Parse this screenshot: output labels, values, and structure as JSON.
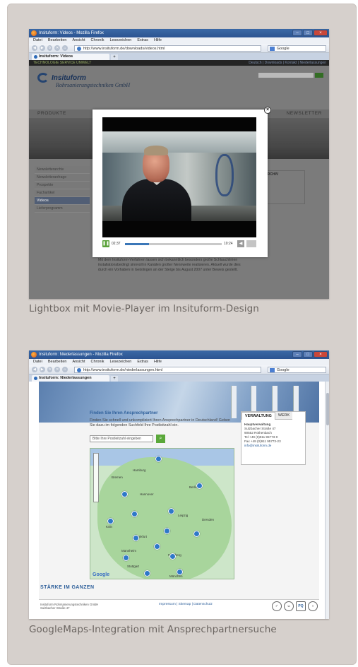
{
  "panels": [
    {
      "window_title": "Insituform: Videos - Mozilla Firefox",
      "menu": [
        "Datei",
        "Bearbeiten",
        "Ansicht",
        "Chronik",
        "Lesezeichen",
        "Extras",
        "Hilfe"
      ],
      "url": "http://www.insituform.de/downloads/videos.html",
      "search_engine": "Google",
      "tab_label": "Insituform: Videos",
      "caption": "Lightbox mit Movie-Player im Insituform-Design"
    },
    {
      "window_title": "Insituform: Niederlassungen - Mozilla Firefox",
      "menu": [
        "Datei",
        "Bearbeiten",
        "Ansicht",
        "Chronik",
        "Lesezeichen",
        "Extras",
        "Hilfe"
      ],
      "url": "http://www.insituform.de/niederlassungen.html",
      "search_engine": "Google",
      "tab_label": "Insituform: Niederlassungen",
      "caption": "GoogleMaps-Integration mit Ansprechpartnersuche"
    }
  ],
  "site1": {
    "top_strip": "TECHNOLOGIE  SERVICE  UMWELT",
    "top_links": "Deutsch | Downloads | Kontakt | Niederlassungen",
    "logo_name": "Insituform",
    "logo_sub": "Rohrsanierungstechniken GmbH",
    "nav_left": "PRODUKTE",
    "nav_right": "NEWSLETTER",
    "sidenav": [
      "Newsletterarchiv",
      "Newsletteranfrage",
      "Prospekte",
      "Fachartikel",
      "Videos",
      "Lieferprogramm"
    ],
    "sidenav_active": 4,
    "archiv_title": "ARCHIV",
    "body_text": "Mit dem Insituform-Verfahren lassen sich bekanntlich besonders große Schlauchlinien installationsbedingt sinnvoll in Kanälen großer Nennweite realisieren. Aktuell wurde dies durch ein Vorhaben in Geislingen an der Steige bis August 2007 unter Beweis gestellt.",
    "player": {
      "current_time": "02:37",
      "total_time": "10:24",
      "progress": 0.25
    }
  },
  "site2": {
    "finder_title": "Finden Sie Ihren Ansprechpartner",
    "finder_text": "Finden Sie schnell und unkompliziert Ihren Ansprechpartner in Deutschland! Geben Sie dazu im folgenden Suchfeld Ihre Postleitzahl ein.",
    "plz_placeholder": "Bitte Ihre Postleitzahl eingeben",
    "tabs": [
      "VERWALTUNG",
      "WERK"
    ],
    "hq_title": "Hauptverwaltung",
    "hq_lines": [
      "Sulzbacher Straße 47",
      "90552 Röthenbach",
      "Tel +49 (0)911 95773-0",
      "Fax +49 (0)911 95773-23"
    ],
    "hq_mail": "info@insituform.de",
    "staerke": "STÄRKE IM GANZEN",
    "footer_addr": [
      "Insituform Rohrsanierungstechniken GmbH",
      "Sulzbacher Straße 47"
    ],
    "footer_links": "Impressum | Sitemap | Datenschutz",
    "badge_pq": "PQ",
    "google_logo": "Google",
    "cities": [
      "Hamburg",
      "Bremen",
      "Berlin",
      "Hannover",
      "Köln",
      "Frankfurt",
      "Stuttgart",
      "München",
      "Nürnberg",
      "Leipzig",
      "Dresden",
      "Mannheim"
    ],
    "pins": 14
  }
}
